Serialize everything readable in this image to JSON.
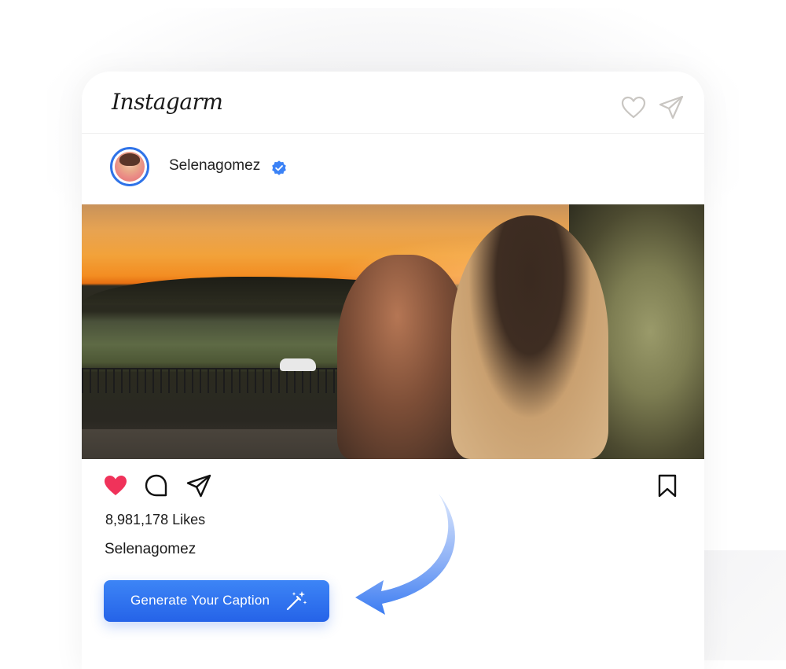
{
  "app": {
    "logo_text": "Instagarm"
  },
  "header_icons": [
    {
      "name": "heart-outline-icon"
    },
    {
      "name": "send-icon"
    }
  ],
  "post": {
    "username": "Selenagomez",
    "verified_icon": "verified-badge-icon",
    "likes_text": "8,981,178 Likes",
    "caption_username": "Selenagomez",
    "liked": true
  },
  "actions": [
    {
      "name": "like-heart-filled-icon"
    },
    {
      "name": "comment-icon"
    },
    {
      "name": "share-icon"
    },
    {
      "name": "bookmark-icon"
    }
  ],
  "cta": {
    "label": "Generate Your Caption",
    "icon": "magic-wand-icon"
  },
  "colors": {
    "accent_blue": "#2f73e8",
    "like_red": "#f0325a",
    "button_blue": "#2563e8"
  }
}
